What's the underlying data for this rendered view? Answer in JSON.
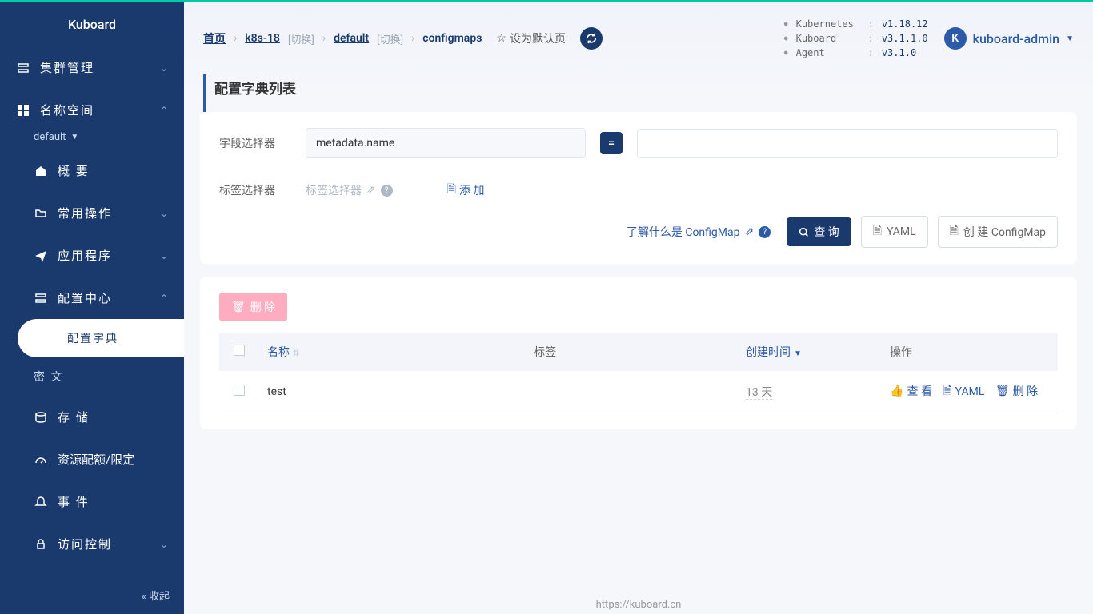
{
  "app_name": "Kuboard",
  "sidebar": {
    "items": [
      {
        "label": "集群管理"
      },
      {
        "label": "名称空间"
      },
      {
        "label": "概 要"
      },
      {
        "label": "常用操作"
      },
      {
        "label": "应用程序"
      },
      {
        "label": "配置中心"
      },
      {
        "label": "配置字典"
      },
      {
        "label": "密 文"
      },
      {
        "label": "存 储"
      },
      {
        "label": "资源配额/限定"
      },
      {
        "label": "事 件"
      },
      {
        "label": "访问控制"
      }
    ],
    "namespace": "default",
    "collapse": "收起"
  },
  "breadcrumb": {
    "home": "首页",
    "cluster": "k8s-18",
    "switch": "[切换]",
    "ns": "default",
    "resource": "configmaps",
    "set_default": "设为默认页"
  },
  "versions": {
    "k8s_name": "Kubernetes",
    "k8s_val": "v1.18.12",
    "kb_name": "Kuboard",
    "kb_val": "v3.1.1.0",
    "ag_name": "Agent",
    "ag_val": "v3.1.0"
  },
  "user": {
    "initial": "K",
    "name": "kuboard-admin"
  },
  "page_title": "配置字典列表",
  "filters": {
    "field_label": "字段选择器",
    "field_value": "metadata.name",
    "tag_label": "标签选择器",
    "tag_placeholder": "标签选择器",
    "add": "添 加"
  },
  "actions": {
    "learn": "了解什么是 ConfigMap",
    "query": "查 询",
    "yaml": "YAML",
    "create": "创 建 ConfigMap",
    "delete": "删 除"
  },
  "table": {
    "cols": {
      "name": "名称",
      "tags": "标签",
      "created": "创建时间",
      "ops": "操作"
    },
    "rows": [
      {
        "name": "test",
        "created": "13 天"
      }
    ],
    "row_actions": {
      "view": "查 看",
      "yaml": "YAML",
      "delete": "删 除"
    }
  },
  "footer_url": "https://kuboard.cn"
}
